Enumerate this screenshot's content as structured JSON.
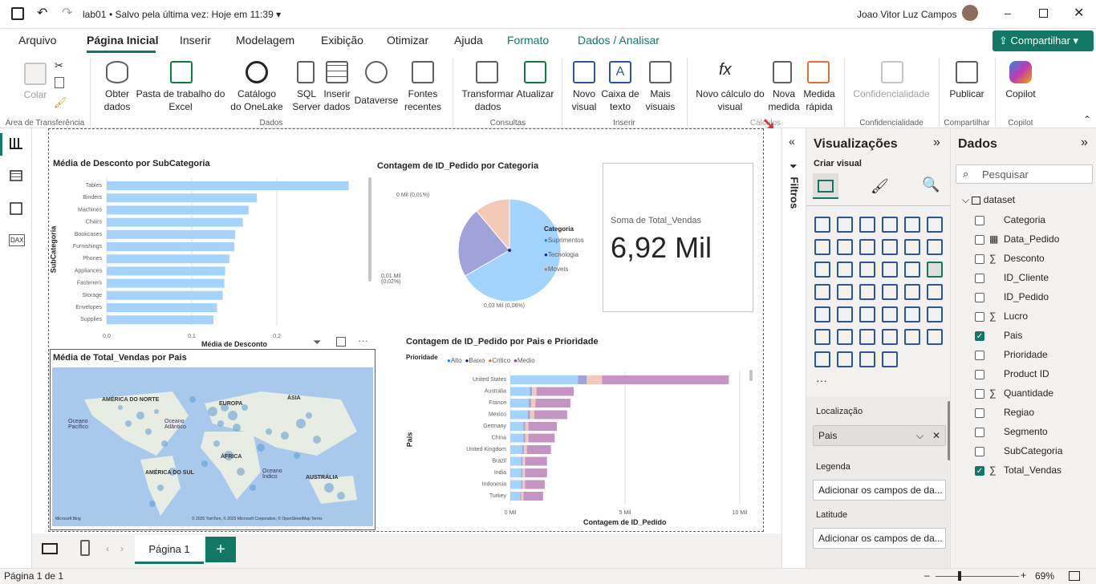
{
  "titlebar": {
    "filename": "lab01",
    "saved": "Salvo pela última vez: Hoje em 11:39",
    "user": "Joao Vitor Luz Campos"
  },
  "menu": [
    "Arquivo",
    "Página Inicial",
    "Inserir",
    "Modelagem",
    "Exibição",
    "Otimizar",
    "Ajuda",
    "Formato",
    "Dados / Analisar"
  ],
  "share_label": "Compartilhar",
  "ribbon": {
    "paste": "Colar",
    "group_clipboard": "Área de Transferência",
    "get_data": "Obter\ndados",
    "excel": "Pasta de trabalho do\nExcel",
    "onelake": "Catálogo\ndo OneLake",
    "sql": "SQL\nServer",
    "enter_data": "Inserir\ndados",
    "dataverse": "Dataverse",
    "recent": "Fontes\nrecentes",
    "group_data": "Dados",
    "transform": "Transformar\ndados",
    "refresh": "Atualizar",
    "group_queries": "Consultas",
    "new_visual": "Novo\nvisual",
    "textbox": "Caixa de\ntexto",
    "more_visuals": "Mais\nvisuais",
    "group_insert": "Inserir",
    "new_calc": "Novo cálculo do\nvisual",
    "new_measure": "Nova\nmedida",
    "quick_measure": "Medida\nrápida",
    "group_calc": "Cálculos",
    "sensitivity": "Confidencialidade",
    "group_sensitivity": "Confidencialidade",
    "publish": "Publicar",
    "group_share": "Compartilhar",
    "copilot": "Copilot",
    "group_copilot": "Copilot"
  },
  "visuals": {
    "bar": {
      "title": "Média de Desconto por SubCategoria",
      "ylabel": "SubCategoria",
      "xlabel": "Média de Desconto"
    },
    "pie": {
      "title": "Contagem de ID_Pedido por Categoria",
      "legend_title": "Categoria",
      "label_small": "0 Mil (0,01%)",
      "label_mid": "0,01 Mil (0,02%)",
      "label_big": "0,03 Mil (0,06%)"
    },
    "card": {
      "label": "Soma de Total_Vendas",
      "value": "6,92 Mil"
    },
    "map": {
      "title": "Média de Total_Vendas por Pais",
      "na": "AMÉRICA DO NORTE",
      "eu": "EUROPA",
      "asia": "ÁSIA",
      "af": "ÁFRICA",
      "sa": "AMÉRICA DO SUL",
      "au": "AUSTRÁLIA",
      "op": "Oceano Pacífico",
      "oa": "Oceano Atlântico",
      "oi": "Oceano Índico",
      "credit": "© 2025 TomTom, © 2025 Microsoft Corporation, © OpenStreetMap  Terms",
      "bing": "Microsoft Bing"
    },
    "stack": {
      "title": "Contagem de ID_Pedido por Pais e Prioridade",
      "legend_title": "Prioridade",
      "ylabel": "Pais",
      "xlabel": "Contagem de ID_Pedido"
    }
  },
  "chart_data": [
    {
      "type": "bar",
      "title": "Média de Desconto por SubCategoria",
      "xlabel": "Média de Desconto",
      "ylabel": "SubCategoria",
      "categories": [
        "Tables",
        "Binders",
        "Machines",
        "Chairs",
        "Bookcases",
        "Furnishings",
        "Phones",
        "Appliances",
        "Fasteners",
        "Storage",
        "Envelopes",
        "Supplies"
      ],
      "values": [
        0.29,
        0.18,
        0.17,
        0.163,
        0.154,
        0.153,
        0.147,
        0.142,
        0.141,
        0.139,
        0.132,
        0.128
      ],
      "xticks": [
        "0,0",
        "0,1",
        "0,2"
      ],
      "xlim": [
        0,
        0.3
      ]
    },
    {
      "type": "pie",
      "title": "Contagem de ID_Pedido por Categoria",
      "labels": [
        "Suprimentos",
        "Tecnologia",
        "Moveis"
      ],
      "values": [
        0.06,
        0.02,
        0.01
      ],
      "colors": [
        "#a3d3ff",
        "#a0a3d8",
        "#f3c9b8"
      ],
      "legend_colors": [
        "#118dff",
        "#12239e",
        "#e66c37"
      ]
    },
    {
      "type": "bar",
      "title": "Contagem de ID_Pedido por Pais e Prioridade",
      "xlabel": "Contagem de ID_Pedido",
      "ylabel": "Pais",
      "categories": [
        "United States",
        "Australia",
        "France",
        "Mexico",
        "Germany",
        "China",
        "United Kingdom",
        "Brazil",
        "India",
        "Indonesia",
        "Turkey"
      ],
      "series": [
        {
          "name": "Alto",
          "values": [
            3.1,
            0.9,
            0.85,
            0.8,
            0.6,
            0.6,
            0.55,
            0.5,
            0.5,
            0.5,
            0.45
          ]
        },
        {
          "name": "Baixo",
          "values": [
            0.4,
            0.1,
            0.1,
            0.1,
            0.08,
            0.08,
            0.07,
            0.06,
            0.06,
            0.06,
            0.05
          ]
        },
        {
          "name": "Critico",
          "values": [
            0.7,
            0.2,
            0.2,
            0.2,
            0.15,
            0.15,
            0.14,
            0.12,
            0.12,
            0.12,
            0.1
          ]
        },
        {
          "name": "Medio",
          "values": [
            5.8,
            1.7,
            1.6,
            1.5,
            1.3,
            1.2,
            1.1,
            1.0,
            1.0,
            0.9,
            0.9
          ]
        }
      ],
      "colors": [
        "#a3d3ff",
        "#a0a3d8",
        "#f3c9b8",
        "#c594c5"
      ],
      "legend_colors": [
        "#118dff",
        "#12239e",
        "#e66c37",
        "#8a3f8a"
      ],
      "xticks": [
        "0 Mil",
        "5 Mil",
        "10 Mil"
      ],
      "xlim": [
        0,
        10.5
      ]
    }
  ],
  "filters_label": "Filtros",
  "vis_pane": {
    "title": "Visualizações",
    "create": "Criar visual",
    "loc": "Localização",
    "loc_value": "Pais",
    "legend": "Legenda",
    "legend_ph": "Adicionar os campos de da...",
    "lat": "Latitude",
    "lat_ph": "Adicionar os campos de da..."
  },
  "data_pane": {
    "title": "Dados",
    "search": "Pesquisar",
    "dataset": "dataset",
    "fields": [
      {
        "name": "Categoria",
        "sigma": false,
        "checked": false
      },
      {
        "name": "Data_Pedido",
        "sigma": false,
        "checked": false,
        "table": true
      },
      {
        "name": "Desconto",
        "sigma": true,
        "checked": false
      },
      {
        "name": "ID_Cliente",
        "sigma": false,
        "checked": false
      },
      {
        "name": "ID_Pedido",
        "sigma": false,
        "checked": false
      },
      {
        "name": "Lucro",
        "sigma": true,
        "checked": false
      },
      {
        "name": "Pais",
        "sigma": false,
        "checked": true
      },
      {
        "name": "Prioridade",
        "sigma": false,
        "checked": false
      },
      {
        "name": "Product ID",
        "sigma": false,
        "checked": false
      },
      {
        "name": "Quantidade",
        "sigma": true,
        "checked": false
      },
      {
        "name": "Regiao",
        "sigma": false,
        "checked": false
      },
      {
        "name": "Segmento",
        "sigma": false,
        "checked": false
      },
      {
        "name": "SubCategoria",
        "sigma": false,
        "checked": false
      },
      {
        "name": "Total_Vendas",
        "sigma": true,
        "checked": true
      }
    ]
  },
  "tabs": {
    "page": "Página 1",
    "add": "+"
  },
  "status": {
    "page_info": "Página 1 de 1",
    "zoom": "69%"
  }
}
